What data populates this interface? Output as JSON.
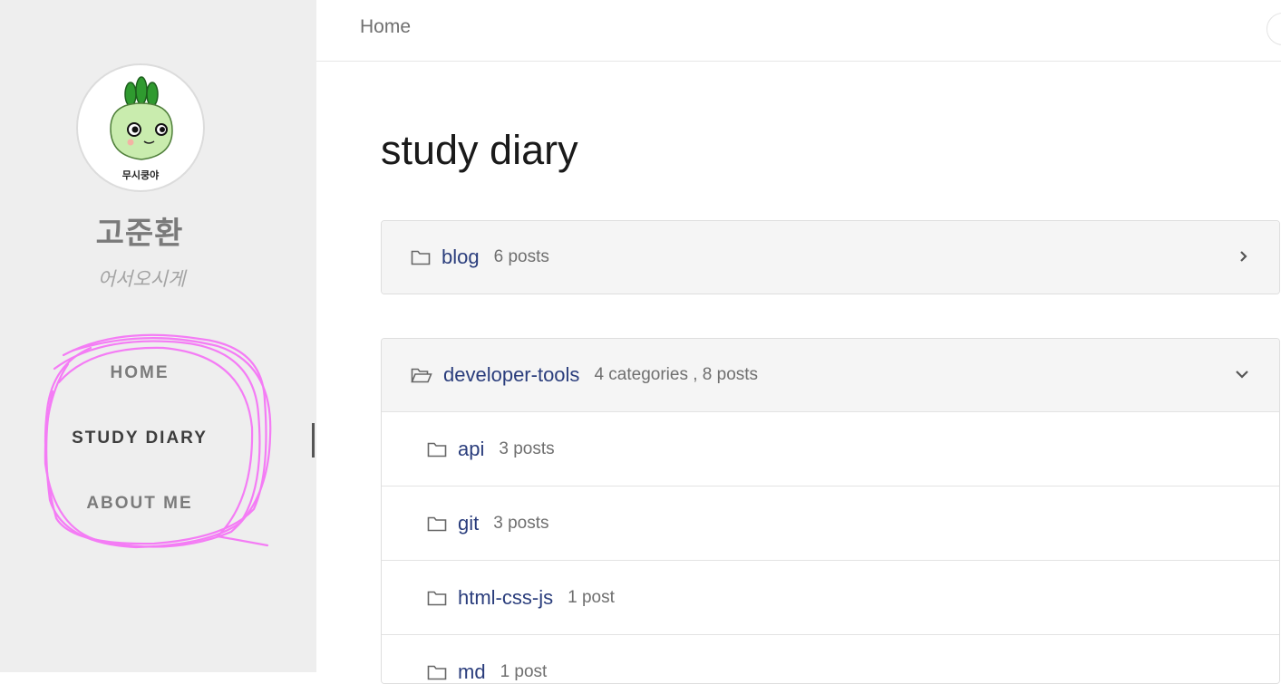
{
  "sidebar": {
    "avatar_caption": "무시쿵야",
    "title": "고준환",
    "subtitle": "어서오시게",
    "nav": [
      {
        "label": "HOME",
        "active": false
      },
      {
        "label": "STUDY DIARY",
        "active": true
      },
      {
        "label": "ABOUT ME",
        "active": false
      }
    ]
  },
  "topbar": {
    "breadcrumb": "Home"
  },
  "main": {
    "title": "study diary",
    "categories": [
      {
        "name": "blog",
        "count": "6 posts",
        "expanded": false
      },
      {
        "name": "developer-tools",
        "count": "4 categories , 8 posts",
        "expanded": true,
        "children": [
          {
            "name": "api",
            "count": "3 posts"
          },
          {
            "name": "git",
            "count": "3 posts"
          },
          {
            "name": "html-css-js",
            "count": "1 post"
          },
          {
            "name": "md",
            "count": "1 post"
          }
        ]
      }
    ]
  },
  "colors": {
    "link": "#2a3d7c",
    "sidebar_bg": "#eeeeee",
    "annotation": "#f47cf5"
  },
  "icons": {
    "folder": "folder-icon",
    "folder_open": "folder-open-icon",
    "chevron_right": "chevron-right-icon",
    "chevron_down": "chevron-down-icon"
  }
}
